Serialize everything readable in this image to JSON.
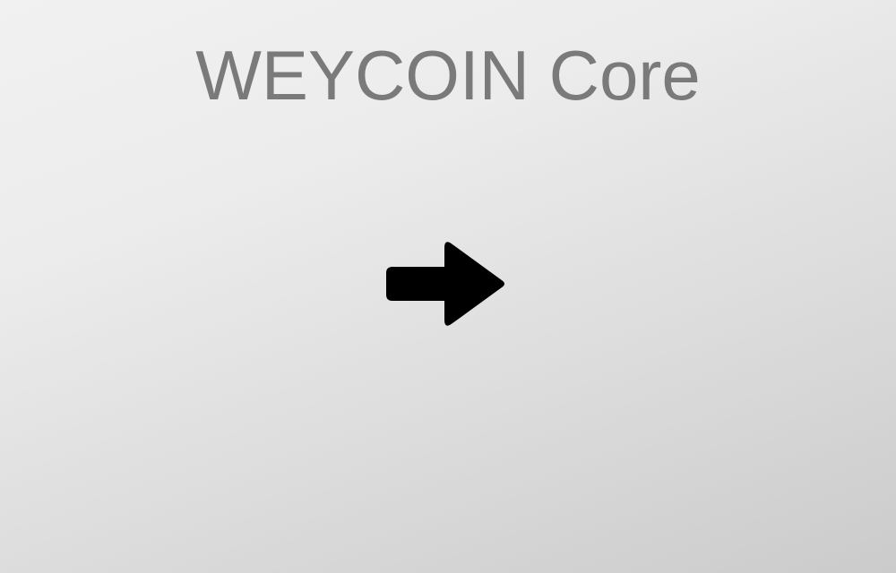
{
  "window": {
    "app_title": "WEYCOIN Core"
  },
  "actions": {
    "continue_icon": "arrow-right-icon",
    "icon_color": "#000000"
  },
  "theme": {
    "title_color": "#7a7a7a",
    "background_light": "#f1f1f1",
    "background_dark": "#cbcbcb"
  }
}
